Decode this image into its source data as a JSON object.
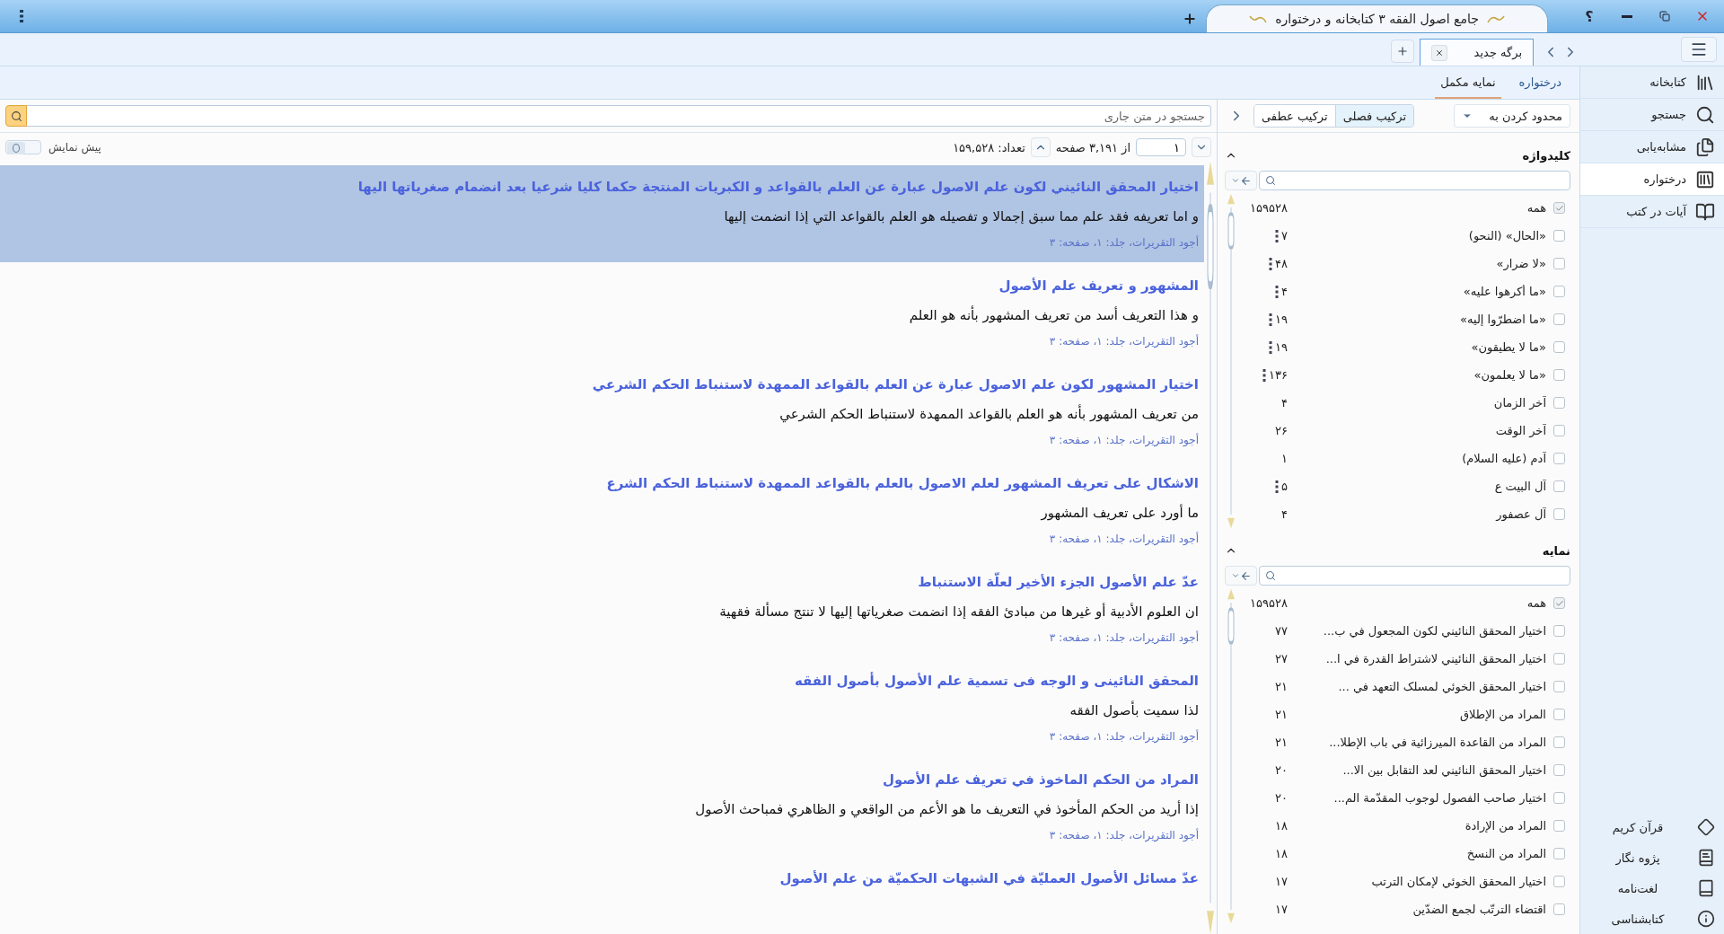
{
  "window": {
    "title": "جامع اصول الفقه ۳ کتابخانه و درختواره",
    "help_button": "؟"
  },
  "tabs": [
    {
      "label": "برگه جدید",
      "selected": true
    }
  ],
  "sidebar": {
    "items": [
      {
        "label": "کتابخانه",
        "selected": false
      },
      {
        "label": "جستجو",
        "selected": false
      },
      {
        "label": "مشابه‌یابی",
        "selected": false
      },
      {
        "label": "درختواره",
        "selected": true
      },
      {
        "label": "آیات در کتب",
        "selected": false
      }
    ],
    "bottom_items": [
      {
        "label": "قرآن کریم"
      },
      {
        "label": "پژوه نگار"
      },
      {
        "label": "لغت‌نامه"
      },
      {
        "label": "کتابشناسی"
      }
    ]
  },
  "subtabs": [
    {
      "label": "درختواره",
      "selected": false
    },
    {
      "label": "نمایه مکمل",
      "selected": true
    }
  ],
  "filter": {
    "limit_dropdown": "محدود کردن به",
    "modes": [
      {
        "label": "ترکیب فصلی",
        "selected": true
      },
      {
        "label": "ترکیب عطفی",
        "selected": false
      }
    ]
  },
  "keyword_panel": {
    "title": "کلیدواژه",
    "items": [
      {
        "label": "همه",
        "count": "۱۵۹۵۲۸",
        "checked": true,
        "marked": false
      },
      {
        "label": "«الحال» (النحو)",
        "count": "۷",
        "checked": false,
        "marked": true
      },
      {
        "label": "«لا ضرار»",
        "count": "۴۸",
        "checked": false,
        "marked": true
      },
      {
        "label": "«ما أكرهوا عليه»",
        "count": "۴",
        "checked": false,
        "marked": true
      },
      {
        "label": "«ما اضطرّوا إليه»",
        "count": "۱۹",
        "checked": false,
        "marked": true
      },
      {
        "label": "«ما لا يطيقون»",
        "count": "۱۹",
        "checked": false,
        "marked": true
      },
      {
        "label": "«ما لا يعلمون»",
        "count": "۱۳۶",
        "checked": false,
        "marked": true
      },
      {
        "label": "آخر الزمان",
        "count": "۴",
        "checked": false,
        "marked": false
      },
      {
        "label": "آخر الوقت",
        "count": "۲۶",
        "checked": false,
        "marked": false
      },
      {
        "label": "آدم (عليه السلام)",
        "count": "۱",
        "checked": false,
        "marked": false
      },
      {
        "label": "آل البيت ع",
        "count": "۵",
        "checked": false,
        "marked": true
      },
      {
        "label": "آل عصفور",
        "count": "۴",
        "checked": false,
        "marked": false
      }
    ]
  },
  "index_panel": {
    "title": "نمایه",
    "items": [
      {
        "label": "همه",
        "count": "۱۵۹۵۲۸",
        "checked": true,
        "marked": false
      },
      {
        "label": "اختيار المحقق النائيني لكون المجعول في ب...",
        "count": "۷۷",
        "checked": false,
        "marked": false
      },
      {
        "label": "اختيار المحقق النائيني لاشتراط القدرة في ا...",
        "count": "۲۷",
        "checked": false,
        "marked": false
      },
      {
        "label": "اختيار المحقق الخوئي لمسلک التعهد في ...",
        "count": "۲۱",
        "checked": false,
        "marked": false
      },
      {
        "label": "المراد من الإطلاق",
        "count": "۲۱",
        "checked": false,
        "marked": false
      },
      {
        "label": "المراد من القاعدة الميرزائية في باب الإطلا...",
        "count": "۲۱",
        "checked": false,
        "marked": false
      },
      {
        "label": "اختيار المحقق النائيني لعد التقابل بين الا...",
        "count": "۲۰",
        "checked": false,
        "marked": false
      },
      {
        "label": "اختيار صاحب الفصول لوجوب المقدّمة الم...",
        "count": "۲۰",
        "checked": false,
        "marked": false
      },
      {
        "label": "المراد من الإرادة",
        "count": "۱۸",
        "checked": false,
        "marked": false
      },
      {
        "label": "المراد من النسخ",
        "count": "۱۸",
        "checked": false,
        "marked": false
      },
      {
        "label": "اختيار المحقق الخوئي لإمكان الترتب",
        "count": "۱۷",
        "checked": false,
        "marked": false
      },
      {
        "label": "اقتضاء الترتّب لجمع الضدّين",
        "count": "۱۷",
        "checked": false,
        "marked": false
      }
    ]
  },
  "search": {
    "placeholder": "جستجو در متن جاری"
  },
  "pager": {
    "page": "۱",
    "of_pages": "از ۳,۱۹۱ صفحه",
    "count": "تعداد: ۱۵۹,۵۲۸"
  },
  "preview": {
    "label": "پیش نمایش",
    "on": false
  },
  "results": [
    {
      "title": "اختيار المحقق النائيني لكون علم الاصول عبارة عن العلم بالقواعد و الكبريات المنتجة حكما كليا شرعيا بعد انضمام صغرياتها اليها",
      "snippet": "و اما تعريفه فقد علم مما سبق إجمالا و تفصيله هو العلم بالقواعد التي إذا انضمت إليها",
      "source": "أجود التقريرات، جلد: ۱، صفحه: ۳",
      "selected": true
    },
    {
      "title": "المشهور و تعريف علم الأصول",
      "snippet": "و هذا التعريف أسد من تعريف المشهور بأنه هو العلم",
      "source": "أجود التقريرات، جلد: ۱، صفحه: ۳",
      "selected": false
    },
    {
      "title": "اختيار المشهور لكون علم الاصول عبارة عن العلم بالقواعد الممهدة لاستنباط الحكم الشرعي",
      "snippet": "من تعريف المشهور بأنه هو العلم بالقواعد الممهدة لاستنباط الحكم الشرعي",
      "source": "أجود التقريرات، جلد: ۱، صفحه: ۳",
      "selected": false
    },
    {
      "title": "الاشكال على تعريف المشهور لعلم الاصول بالعلم بالقواعد الممهدة لاستنباط الحكم الشرع",
      "snippet": "ما أورد على تعريف المشهور",
      "source": "أجود التقريرات، جلد: ۱، صفحه: ۳",
      "selected": false
    },
    {
      "title": "عدّ علم الأصول الجزء الأخير لعلّة الاستنباط",
      "snippet": "ان العلوم الأدبية أو غيرها من مبادئ الفقه إذا انضمت صغرياتها إليها لا تنتج مسألة فقهية",
      "source": "أجود التقريرات، جلد: ۱، صفحه: ۳",
      "selected": false
    },
    {
      "title": "المحقق النائينى و الوجه فى تسمية علم الأصول بأصول الفقه",
      "snippet": "لذا سميت بأصول الفقه",
      "source": "أجود التقريرات، جلد: ۱، صفحه: ۳",
      "selected": false
    },
    {
      "title": "المراد من الحكم الماخوذ في تعريف علم الأصول",
      "snippet": "إذا أريد من الحكم المأخوذ في التعريف ما هو الأعم من الواقعي و الظاهري فمباحث الأصول",
      "source": "أجود التقريرات، جلد: ۱، صفحه: ۳",
      "selected": false
    },
    {
      "title": "عدّ مسائل الأصول العمليّة في الشبهات الحكميّة من علم الأصول",
      "selected": false
    }
  ]
}
